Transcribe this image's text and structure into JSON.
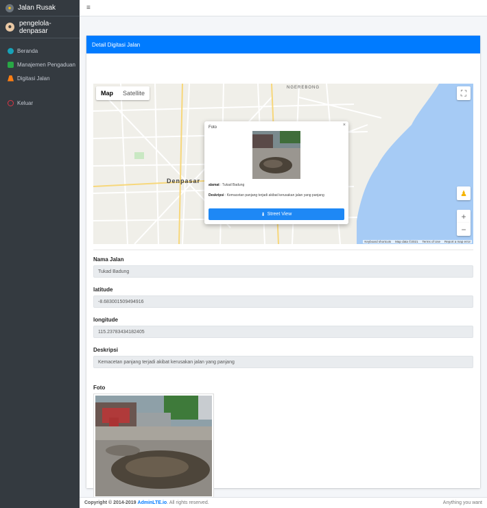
{
  "app": {
    "brand": "Jalan Rusak",
    "user": "pengelola-denpasar"
  },
  "sidebar": {
    "items": [
      {
        "label": "Beranda",
        "icon": "dashboard-icon",
        "color": "#17a2b8"
      },
      {
        "label": "Manajemen Pengaduan",
        "icon": "book-icon",
        "color": "#28a745"
      },
      {
        "label": "Digitasi Jalan",
        "icon": "road-icon",
        "color": "#fd7e14"
      },
      {
        "label": "Keluar",
        "icon": "power-icon",
        "color": "#dc3545"
      }
    ]
  },
  "card": {
    "title": "Detail Digitasi Jalan"
  },
  "map": {
    "type_map": "Map",
    "type_satellite": "Satellite",
    "city": "Denpasar",
    "area_label": "NGEREBONG",
    "attribution": {
      "shortcuts": "Keyboard shortcuts",
      "data": "Map data ©2021",
      "terms": "Terms of Use",
      "report": "Report a map error"
    },
    "popup": {
      "title": "Foto",
      "alamat_label": "alamat",
      "alamat_value": "Tukad Badung",
      "deskripsi_label": "Deskripsi",
      "deskripsi_value": "Kemacetan panjang terjadi akibat kerusakan jalan yang panjang",
      "button": "Street View"
    }
  },
  "fields": {
    "nama_label": "Nama Jalan",
    "nama_value": "Tukad Badung",
    "lat_label": "latitude",
    "lat_value": "-8.683001509494916",
    "lng_label": "longitude",
    "lng_value": "115.23783434182405",
    "desc_label": "Deskripsi",
    "desc_value": "Kemacetan panjang terjadi akibat kerusakan jalan yang panjang",
    "foto_label": "Foto"
  },
  "footer": {
    "copyright": "Copyright © 2014-2019",
    "brand": "AdminLTE.io",
    "rights": ". All rights reserved.",
    "right_text": "Anything you want"
  },
  "colors": {
    "primary": "#007bff",
    "sidebar": "#343a40",
    "water": "#a6cbf5"
  }
}
